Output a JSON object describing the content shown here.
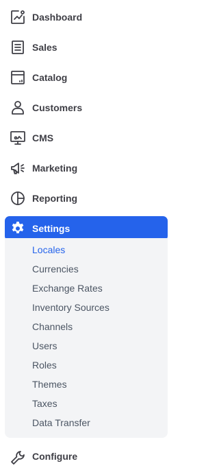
{
  "colors": {
    "accent": "#2563eb",
    "text": "#3f3f46",
    "submenu_text": "#4b5563",
    "submenu_bg": "#f3f4f6"
  },
  "nav": {
    "items": [
      {
        "label": "Dashboard",
        "icon": "dashboard-chart-icon"
      },
      {
        "label": "Sales",
        "icon": "receipt-icon"
      },
      {
        "label": "Catalog",
        "icon": "catalog-box-icon"
      },
      {
        "label": "Customers",
        "icon": "user-icon"
      },
      {
        "label": "CMS",
        "icon": "monitor-icon"
      },
      {
        "label": "Marketing",
        "icon": "megaphone-icon"
      },
      {
        "label": "Reporting",
        "icon": "pie-chart-icon"
      },
      {
        "label": "Settings",
        "icon": "gear-icon",
        "active": true
      },
      {
        "label": "Configure",
        "icon": "wrench-icon"
      }
    ]
  },
  "settings_submenu": {
    "items": [
      {
        "label": "Locales",
        "active": true
      },
      {
        "label": "Currencies"
      },
      {
        "label": "Exchange Rates"
      },
      {
        "label": "Inventory Sources"
      },
      {
        "label": "Channels"
      },
      {
        "label": "Users"
      },
      {
        "label": "Roles"
      },
      {
        "label": "Themes"
      },
      {
        "label": "Taxes"
      },
      {
        "label": "Data Transfer"
      }
    ]
  }
}
